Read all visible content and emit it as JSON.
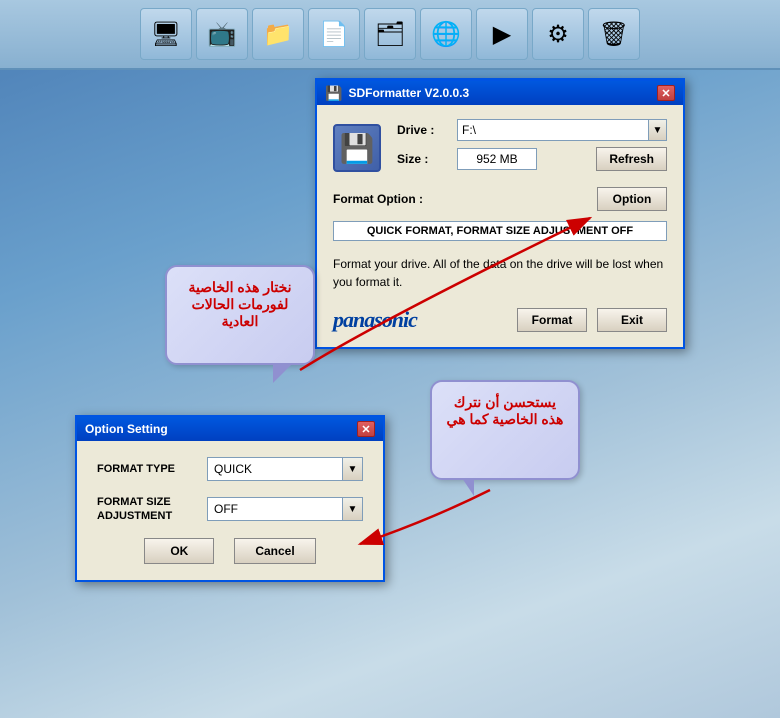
{
  "desktop": {
    "icons": [
      {
        "name": "my-computer",
        "symbol": "🖥"
      },
      {
        "name": "network",
        "symbol": "📺"
      },
      {
        "name": "folder",
        "symbol": "📁"
      },
      {
        "name": "documents",
        "symbol": "📄"
      },
      {
        "name": "recycle",
        "symbol": "🗂"
      },
      {
        "name": "internet",
        "symbol": "🌐"
      },
      {
        "name": "media",
        "symbol": "▶"
      },
      {
        "name": "settings",
        "symbol": "⚙"
      },
      {
        "name": "trash",
        "symbol": "🗑"
      }
    ]
  },
  "sdformatter": {
    "title": "SDFormatter V2.0.0.3",
    "drive_label": "Drive :",
    "drive_value": "F:\\",
    "size_label": "Size :",
    "size_value": "952  MB",
    "refresh_label": "Refresh",
    "format_option_label": "Format Option :",
    "option_label": "Option",
    "option_display": "QUICK FORMAT, FORMAT SIZE ADJUSTMENT OFF",
    "warning_text": "Format your drive. All of the data on the drive will be lost when you format it.",
    "panasonic": "panasonic",
    "format_label": "Format",
    "exit_label": "Exit",
    "close_label": "✕"
  },
  "option_dialog": {
    "title": "Option Setting",
    "close_label": "✕",
    "format_type_label": "FORMAT TYPE",
    "format_type_value": "QUICK",
    "format_size_label": "FORMAT SIZE\nADJUSTMENT",
    "format_size_value": "OFF",
    "ok_label": "OK",
    "cancel_label": "Cancel"
  },
  "bubble_left": {
    "text": "نختار هذه الخاصية لفورمات الحالات العادية"
  },
  "bubble_right": {
    "text": "يستحسن أن نترك هذه الخاصية كما هي"
  }
}
